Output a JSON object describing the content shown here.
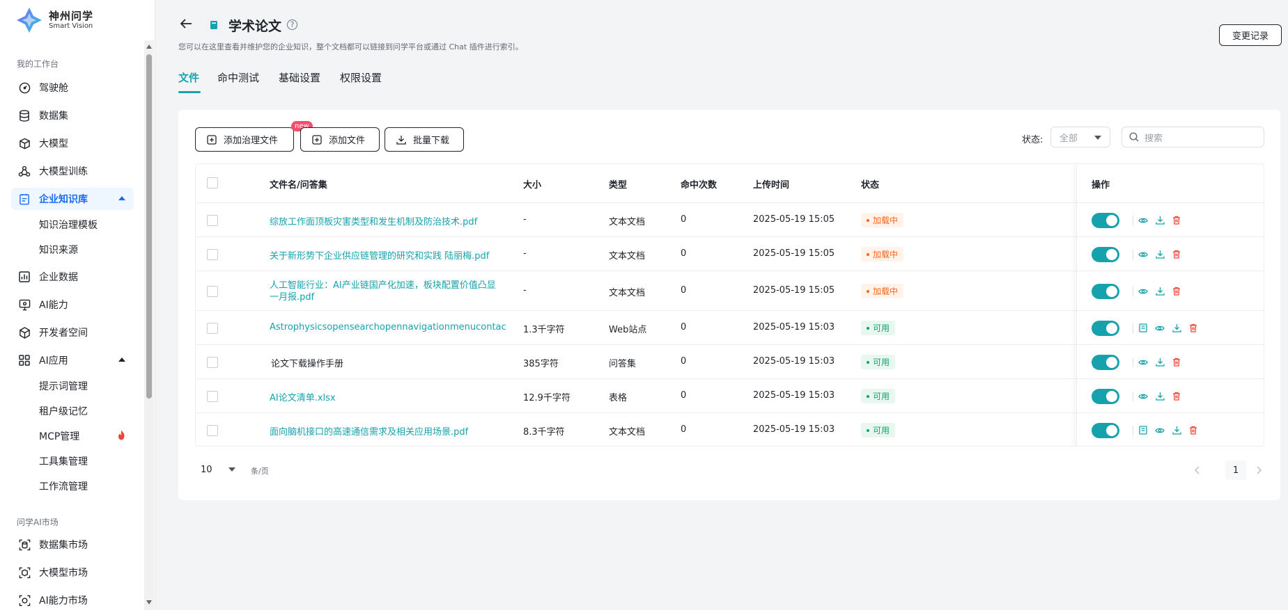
{
  "brand": {
    "name_cn": "神州问学",
    "name_en": "Smart Vision"
  },
  "sidebar": {
    "group_workspace": "我的工作台",
    "items": [
      {
        "label": "驾驶舱",
        "icon": "dashboard-icon"
      },
      {
        "label": "数据集",
        "icon": "database-icon"
      },
      {
        "label": "大模型",
        "icon": "cube-icon"
      },
      {
        "label": "大模型训练",
        "icon": "training-icon"
      },
      {
        "label": "企业知识库",
        "icon": "knowledge-icon",
        "active": true
      },
      {
        "label": "企业数据",
        "icon": "chart-icon"
      },
      {
        "label": "AI能力",
        "icon": "monitor-icon"
      },
      {
        "label": "开发者空间",
        "icon": "hexagon-icon"
      },
      {
        "label": "AI应用",
        "icon": "apps-icon"
      }
    ],
    "knowledge_subitems": [
      "知识治理模板",
      "知识来源"
    ],
    "ai_app_subitems": [
      "提示词管理",
      "租户级记忆",
      "MCP管理",
      "工具集管理",
      "工作流管理"
    ],
    "group_market": "问学AI市场",
    "market_items": [
      {
        "label": "数据集市场",
        "icon": "dataset-market-icon"
      },
      {
        "label": "大模型市场",
        "icon": "model-market-icon"
      },
      {
        "label": "AI能力市场",
        "icon": "ability-market-icon"
      }
    ]
  },
  "header": {
    "title": "学术论文",
    "subtitle": "您可以在这里查看并维护您的企业知识，整个文档都可以链接到问学平台或通过 Chat 插件进行索引。",
    "changelog": "变更记录"
  },
  "tabs": [
    "文件",
    "命中测试",
    "基础设置",
    "权限设置"
  ],
  "toolbar": {
    "add_governance": "添加治理文件",
    "new_badge": "new",
    "add_file": "添加文件",
    "batch_download": "批量下载",
    "status_label": "状态:",
    "status_value": "全部",
    "search_placeholder": "搜索"
  },
  "table": {
    "columns": [
      "文件名/问答集",
      "大小",
      "类型",
      "命中次数",
      "上传时间",
      "状态",
      "操作"
    ],
    "rows": [
      {
        "name": "综放工作面顶板灾害类型和发生机制及防治技术.pdf",
        "size": "-",
        "type": "文本文档",
        "hits": "0",
        "time": "2025-05-19 15:05",
        "status": "加载中",
        "status_kind": "loading",
        "link": true,
        "edit": false
      },
      {
        "name": "关于新形势下企业供应链管理的研究和实践  陆丽梅.pdf",
        "size": "-",
        "type": "文本文档",
        "hits": "0",
        "time": "2025-05-19 15:05",
        "status": "加载中",
        "status_kind": "loading",
        "link": true,
        "edit": false
      },
      {
        "name": "人工智能行业：AI产业链国产化加速，板块配置价值凸显",
        "name2": "一月报.pdf",
        "size": "-",
        "type": "文本文档",
        "hits": "0",
        "time": "2025-05-19 15:05",
        "status": "加载中",
        "status_kind": "loading",
        "link": true,
        "edit": false
      },
      {
        "name": "Astrophysicsopensearchopennavigationmenucontac",
        "size": "1.3千字符",
        "type": "Web站点",
        "hits": "0",
        "time": "2025-05-19 15:03",
        "status": "可用",
        "status_kind": "ok",
        "link": true,
        "edit": true
      },
      {
        "name": "论文下载操作手册",
        "size": "385字符",
        "type": "问答集",
        "hits": "0",
        "time": "2025-05-19 15:03",
        "status": "可用",
        "status_kind": "ok",
        "link": false,
        "edit": false
      },
      {
        "name": "AI论文清单.xlsx",
        "size": "12.9千字符",
        "type": "表格",
        "hits": "0",
        "time": "2025-05-19 15:03",
        "status": "可用",
        "status_kind": "ok",
        "link": true,
        "edit": false
      },
      {
        "name": "面向脑机接口的高速通信需求及相关应用场景.pdf",
        "size": "8.3千字符",
        "type": "文本文档",
        "hits": "0",
        "time": "2025-05-19 15:03",
        "status": "可用",
        "status_kind": "ok",
        "link": true,
        "edit": true
      }
    ]
  },
  "pagination": {
    "page_size": "10",
    "per_page_label": "条/页",
    "current": "1"
  },
  "colors": {
    "accent": "#16a2ac",
    "active_nav": "#1a6cf2",
    "loading": "#f7661d",
    "ok": "#12a06d",
    "danger": "#f04438"
  }
}
